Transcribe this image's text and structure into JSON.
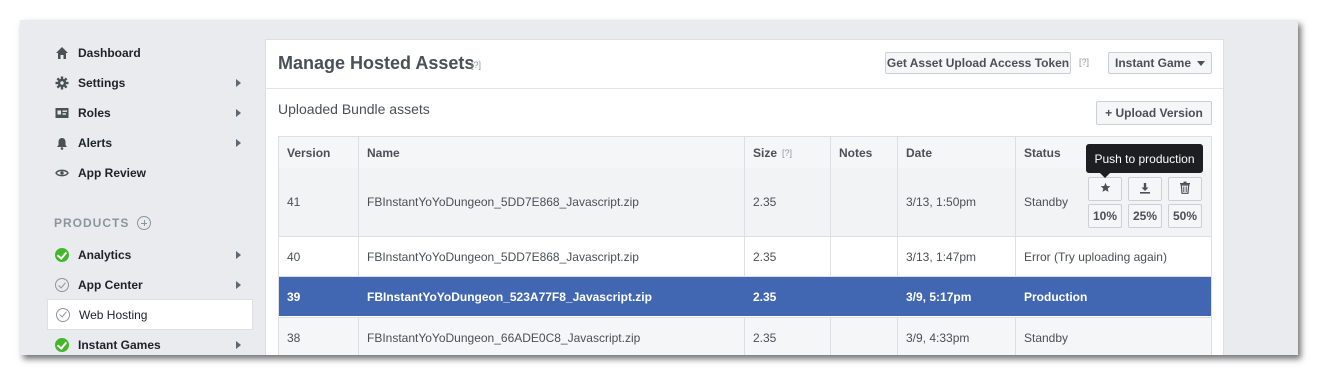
{
  "sidebar": {
    "items": [
      {
        "label": "Dashboard",
        "icon": "home-icon"
      },
      {
        "label": "Settings",
        "icon": "gear-icon"
      },
      {
        "label": "Roles",
        "icon": "id-card-icon"
      },
      {
        "label": "Alerts",
        "icon": "bell-icon"
      },
      {
        "label": "App Review",
        "icon": "eye-icon"
      }
    ],
    "products_heading": "PRODUCTS",
    "products": [
      {
        "label": "Analytics",
        "status": "enabled"
      },
      {
        "label": "App Center",
        "status": "disabled"
      },
      {
        "label": "Web Hosting",
        "status": "disabled"
      },
      {
        "label": "Instant Games",
        "status": "enabled"
      }
    ]
  },
  "panel": {
    "title": "Manage Hosted Assets",
    "help": "[?]",
    "token_button": "Get Asset Upload Access Token",
    "game_select": "Instant Game",
    "section_label": "Uploaded Bundle assets",
    "upload_button": "+ Upload Version"
  },
  "table": {
    "headers": {
      "version": "Version",
      "name": "Name",
      "size": "Size",
      "size_help": "[?]",
      "notes": "Notes",
      "date": "Date",
      "status": "Status"
    },
    "rows": [
      {
        "version": "41",
        "name": "FBInstantYoYoDungeon_5DD7E868_Javascript.zip",
        "size": "2.35",
        "notes": "",
        "date": "3/13, 1:50pm",
        "status": "Standby"
      },
      {
        "version": "40",
        "name": "FBInstantYoYoDungeon_5DD7E868_Javascript.zip",
        "size": "2.35",
        "notes": "",
        "date": "3/13, 1:47pm",
        "status": "Error (Try uploading again)"
      },
      {
        "version": "39",
        "name": "FBInstantYoYoDungeon_523A77F8_Javascript.zip",
        "size": "2.35",
        "notes": "",
        "date": "3/9, 5:17pm",
        "status": "Production"
      },
      {
        "version": "38",
        "name": "FBInstantYoYoDungeon_66ADE0C8_Javascript.zip",
        "size": "2.35",
        "notes": "",
        "date": "3/9, 4:33pm",
        "status": "Standby"
      }
    ],
    "row_actions": {
      "pct_10": "10%",
      "pct_25": "25%",
      "pct_50": "50%"
    },
    "tooltip": "Push to production"
  },
  "colors": {
    "selected_row": "#4267b2",
    "check_green": "#42b72a",
    "background": "#e9ebee"
  }
}
